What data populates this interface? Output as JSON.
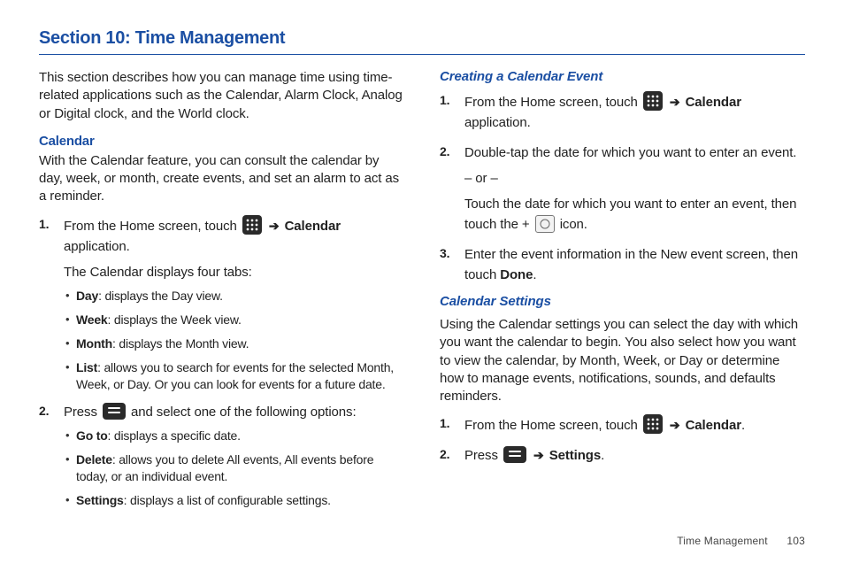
{
  "section_title": "Section 10: Time Management",
  "left": {
    "intro": "This section describes how you can manage time using time-related applications such as the Calendar, Alarm Clock, Analog or Digital clock, and the World clock.",
    "calendar_heading": "Calendar",
    "calendar_intro": "With the Calendar feature, you can consult the calendar by day, week, or month, create events, and set an alarm to act as a reminder.",
    "step1_pre": "From the Home screen, touch ",
    "arrow": "➔",
    "calendar_word": "Calendar",
    "step1_post": " application.",
    "step1_line2": "The Calendar displays four tabs:",
    "bullets1": {
      "day_b": "Day",
      "day_t": ": displays the Day view.",
      "week_b": "Week",
      "week_t": ": displays the Week view.",
      "month_b": "Month",
      "month_t": ": displays the Month view.",
      "list_b": "List",
      "list_t": ": allows you to search for events for the selected Month, Week, or Day. Or you can look for events for a future date."
    },
    "step2_pre": "Press ",
    "step2_post": " and select one of the following options:",
    "bullets2": {
      "goto_b": "Go to",
      "goto_t": ": displays a specific date.",
      "delete_b": "Delete",
      "delete_t": ": allows you to delete All events, All events before today, or an individual event.",
      "settings_b": "Settings",
      "settings_t": ": displays a list of configurable settings."
    }
  },
  "right": {
    "creating_heading": "Creating a Calendar Event",
    "c1_pre": "From the Home screen, touch ",
    "arrow": "➔",
    "calendar_word": "Calendar",
    "c1_post": " application.",
    "c2_a": "Double-tap the date for which you want to enter an event.",
    "c2_or": "– or –",
    "c2_b_pre": "Touch the date for which you want to enter an event, then touch the + ",
    "c2_b_post": " icon.",
    "c3_pre": "Enter the event information in the New event screen, then touch ",
    "done_word": "Done",
    "c3_post": ".",
    "settings_heading": "Calendar Settings",
    "settings_intro": "Using the Calendar settings you can select the day with which you want the calendar to begin. You also select how you want to view the calendar, by Month, Week, or Day or determine how to manage events, notifications, sounds, and defaults reminders.",
    "s1_pre": "From the Home screen, touch ",
    "s1_post": ".",
    "s2_pre": "Press ",
    "settings_word": "Settings",
    "s2_post": "."
  },
  "footer": {
    "label": "Time Management",
    "page": "103"
  }
}
